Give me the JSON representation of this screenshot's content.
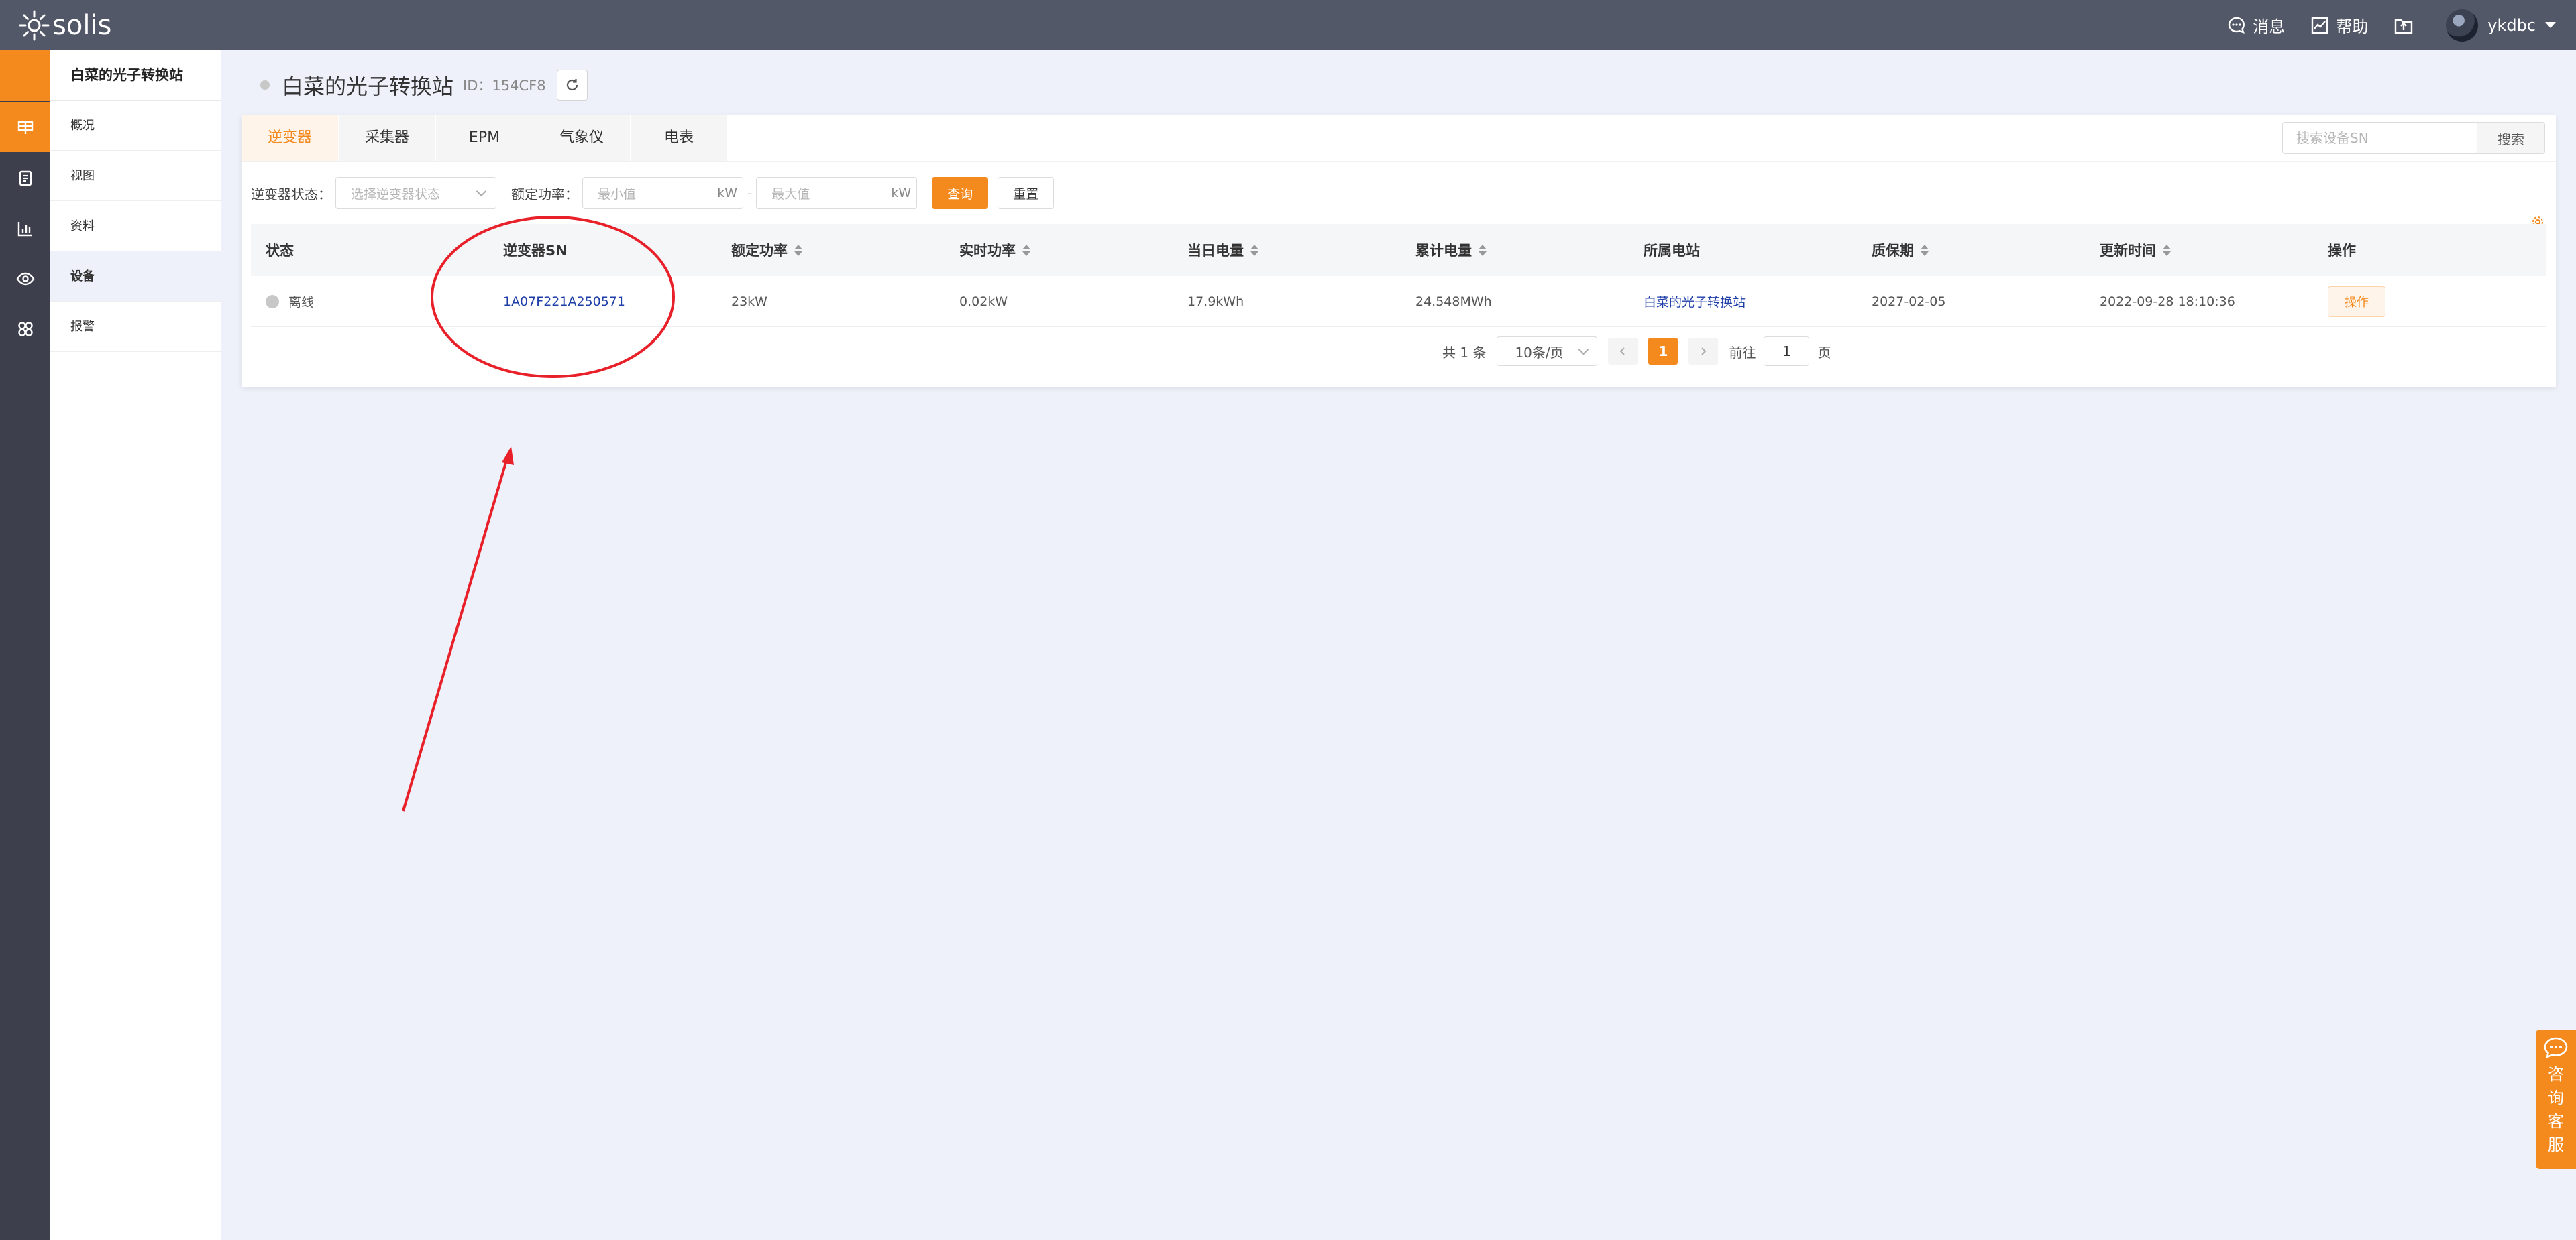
{
  "brand": {
    "name": "solis"
  },
  "topbar": {
    "messages_label": "消息",
    "help_label": "帮助",
    "username": "ykdbc"
  },
  "sidebar": {
    "title": "白菜的光子转换站",
    "items": [
      {
        "label": "概况",
        "active": false
      },
      {
        "label": "视图",
        "active": false
      },
      {
        "label": "资料",
        "active": false
      },
      {
        "label": "设备",
        "active": true
      },
      {
        "label": "报警",
        "active": false
      }
    ]
  },
  "page": {
    "title": "白菜的光子转换站",
    "id_text": "ID：154CF8"
  },
  "tabs": [
    {
      "label": "逆变器",
      "active": true
    },
    {
      "label": "采集器",
      "active": false
    },
    {
      "label": "EPM",
      "active": false
    },
    {
      "label": "气象仪",
      "active": false
    },
    {
      "label": "电表",
      "active": false
    }
  ],
  "search": {
    "placeholder": "搜索设备SN",
    "button": "搜索"
  },
  "filters": {
    "status_label": "逆变器状态：",
    "status_placeholder": "选择逆变器状态",
    "power_label": "额定功率：",
    "min_placeholder": "最小值",
    "max_placeholder": "最大值",
    "unit": "kW",
    "separator": "-",
    "query_button": "查询",
    "reset_button": "重置"
  },
  "table": {
    "columns": [
      "状态",
      "逆变器SN",
      "额定功率",
      "实时功率",
      "当日电量",
      "累计电量",
      "所属电站",
      "质保期",
      "更新时间",
      "操作"
    ],
    "rows": [
      {
        "status": "离线",
        "sn": "1A07F221A250571",
        "rated_power": "23kW",
        "realtime_power": "0.02kW",
        "daily_energy": "17.9kWh",
        "total_energy": "24.548MWh",
        "station": "白菜的光子转换站",
        "warranty": "2027-02-05",
        "updated": "2022-09-28 18:10:36",
        "action": "操作"
      }
    ]
  },
  "pagination": {
    "total": "共 1 条",
    "page_size": "10条/页",
    "current": "1",
    "goto_label": "前往",
    "goto_value": "1",
    "page_suffix": "页"
  },
  "consult": {
    "label": "咨询客服"
  },
  "colors": {
    "topbar": "#535868",
    "rail": "#3d404c",
    "accent": "#f4891d",
    "link": "#1e3ea8",
    "annotation": "#e8202a"
  }
}
